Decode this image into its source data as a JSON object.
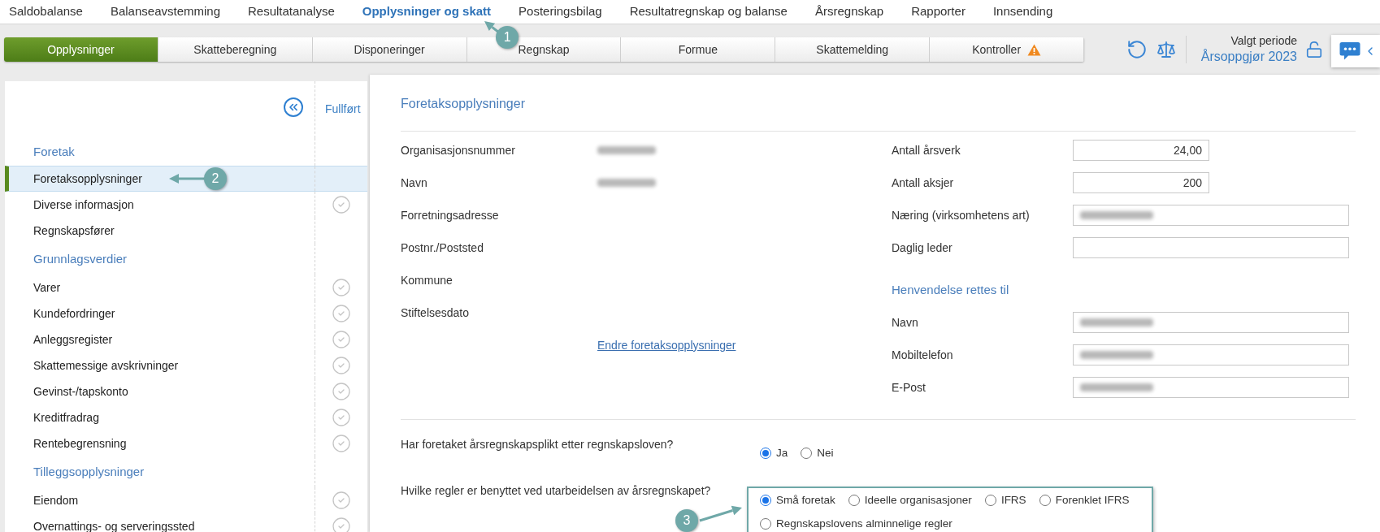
{
  "top_nav": [
    {
      "label": "Saldobalanse",
      "selected": false
    },
    {
      "label": "Balanseavstemming",
      "selected": false
    },
    {
      "label": "Resultatanalyse",
      "selected": false
    },
    {
      "label": "Opplysninger og skatt",
      "selected": true,
      "callout": "1"
    },
    {
      "label": "Posteringsbilag",
      "selected": false
    },
    {
      "label": "Resultatregnskap og balanse",
      "selected": false
    },
    {
      "label": "Årsregnskap",
      "selected": false
    },
    {
      "label": "Rapporter",
      "selected": false
    },
    {
      "label": "Innsending",
      "selected": false
    }
  ],
  "sub_tabs": [
    {
      "label": "Opplysninger",
      "selected": true,
      "warning": false
    },
    {
      "label": "Skatteberegning",
      "selected": false,
      "warning": false
    },
    {
      "label": "Disponeringer",
      "selected": false,
      "warning": false
    },
    {
      "label": "Regnskap",
      "selected": false,
      "warning": false
    },
    {
      "label": "Formue",
      "selected": false,
      "warning": false
    },
    {
      "label": "Skattemelding",
      "selected": false,
      "warning": false
    },
    {
      "label": "Kontroller",
      "selected": false,
      "warning": true
    }
  ],
  "period": {
    "label": "Valgt periode",
    "value": "Årsoppgjør 2023"
  },
  "sidebar": {
    "status_header": "Fullført",
    "sections": [
      {
        "title": "Foretak",
        "items": [
          {
            "label": "Foretaksopplysninger",
            "selected": true,
            "completed": false,
            "callout": "2"
          },
          {
            "label": "Diverse informasjon",
            "selected": false,
            "completed": true
          },
          {
            "label": "Regnskapsfører",
            "selected": false,
            "completed": false
          }
        ]
      },
      {
        "title": "Grunnlagsverdier",
        "items": [
          {
            "label": "Varer",
            "selected": false,
            "completed": true
          },
          {
            "label": "Kundefordringer",
            "selected": false,
            "completed": true
          },
          {
            "label": "Anleggsregister",
            "selected": false,
            "completed": true
          },
          {
            "label": "Skattemessige avskrivninger",
            "selected": false,
            "completed": true
          },
          {
            "label": "Gevinst-/tapskonto",
            "selected": false,
            "completed": true
          },
          {
            "label": "Kreditfradrag",
            "selected": false,
            "completed": true
          },
          {
            "label": "Rentebegrensning",
            "selected": false,
            "completed": true
          }
        ]
      },
      {
        "title": "Tilleggsopplysninger",
        "items": [
          {
            "label": "Eiendom",
            "selected": false,
            "completed": true
          },
          {
            "label": "Overnattings- og serveringssted",
            "selected": false,
            "completed": true
          }
        ]
      }
    ]
  },
  "form": {
    "title": "Foretaksopplysninger",
    "left_fields": [
      {
        "label": "Organisasjonsnummer",
        "blurred": true
      },
      {
        "label": "Navn",
        "blurred": true
      },
      {
        "label": "Forretningsadresse",
        "blurred": false
      },
      {
        "label": "Postnr./Poststed",
        "blurred": false
      },
      {
        "label": "Kommune",
        "blurred": false
      },
      {
        "label": "Stiftelsesdato",
        "blurred": false
      }
    ],
    "edit_link": "Endre foretaksopplysninger",
    "right_fields": [
      {
        "label": "Antall årsverk",
        "kind": "number",
        "value": "24,00",
        "blurred": false
      },
      {
        "label": "Antall aksjer",
        "kind": "number",
        "value": "200",
        "blurred": false
      },
      {
        "label": "Næring (virksomhetens art)",
        "kind": "text",
        "blurred": true
      },
      {
        "label": "Daglig leder",
        "kind": "text",
        "blurred": false
      }
    ],
    "contact_title": "Henvendelse rettes til",
    "contact_fields": [
      {
        "label": "Navn",
        "kind": "text",
        "blurred": true
      },
      {
        "label": "Mobiltelefon",
        "kind": "text",
        "blurred": true
      },
      {
        "label": "E-Post",
        "kind": "text",
        "blurred": true
      }
    ],
    "questions": [
      {
        "text": "Har foretaket årsregnskapsplikt etter regnskapsloven?",
        "highlighted": false,
        "options": [
          {
            "label": "Ja",
            "selected": true
          },
          {
            "label": "Nei",
            "selected": false
          }
        ]
      },
      {
        "text": "Hvilke regler er benyttet ved utarbeidelsen av årsregnskapet?",
        "highlighted": true,
        "callout": "3",
        "options": [
          {
            "label": "Små foretak",
            "selected": true
          },
          {
            "label": "Ideelle organisasjoner",
            "selected": false
          },
          {
            "label": "IFRS",
            "selected": false
          },
          {
            "label": "Forenklet IFRS",
            "selected": false
          },
          {
            "label": "Regnskapslovens alminnelige regler",
            "selected": false
          }
        ]
      }
    ]
  }
}
